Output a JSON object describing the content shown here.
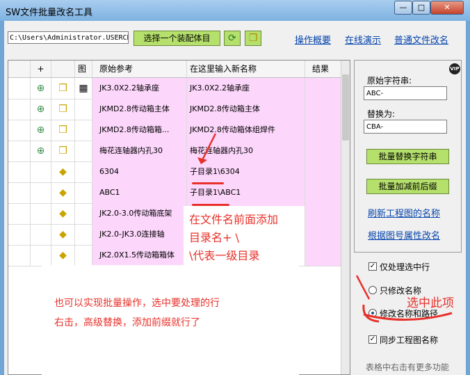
{
  "window": {
    "title": "SW文件批量改名工具",
    "minimize": "—",
    "maximize": "□",
    "close": "✕"
  },
  "toolbar": {
    "path_value": "C:\\Users\\Administrator.USERCH",
    "select_assembly_label": "选择一个装配体目",
    "refresh_icon": "refresh-icon",
    "assembly_icon": "assembly-icon"
  },
  "links": {
    "overview": "操作概要",
    "demo": "在线演示",
    "normal_rename": "普通文件改名"
  },
  "table": {
    "headers": {
      "plus": "+",
      "drawing": "图",
      "original": "原始参考",
      "new_name": "在这里输入新名称",
      "result": "结果"
    },
    "rows": [
      {
        "expand": "⊕",
        "icon": "assembly",
        "has_drawing": true,
        "original": "JK3.0X2.2轴承座",
        "new_name": "JK3.0X2.2轴承座"
      },
      {
        "expand": "⊕",
        "icon": "assembly",
        "has_drawing": false,
        "original": "JKMD2.8传动箱主体",
        "new_name": "JKMD2.8传动箱主体"
      },
      {
        "expand": "⊕",
        "icon": "assembly",
        "has_drawing": false,
        "original": "JKMD2.8传动箱箱...",
        "new_name": "JKMD2.8传动箱体组焊件"
      },
      {
        "expand": "⊕",
        "icon": "assembly",
        "has_drawing": false,
        "original": "梅花连轴器内孔30",
        "new_name": "梅花连轴器内孔30"
      },
      {
        "expand": "",
        "icon": "part",
        "has_drawing": false,
        "original": "6304",
        "new_name": "子目录1\\6304"
      },
      {
        "expand": "",
        "icon": "part",
        "has_drawing": false,
        "original": "ABC1",
        "new_name": "子目录1\\ABC1"
      },
      {
        "expand": "",
        "icon": "part",
        "has_drawing": false,
        "original": "JK2.0-3.0传动箱底架",
        "new_name": ""
      },
      {
        "expand": "",
        "icon": "part",
        "has_drawing": false,
        "original": "JK2.0-JK3.0连接轴",
        "new_name": ""
      },
      {
        "expand": "",
        "icon": "part",
        "has_drawing": false,
        "original": "JK2.0X1.5传动箱箱体",
        "new_name": ""
      }
    ]
  },
  "side": {
    "vip": "VIP",
    "find_label": "原始字符串:",
    "find_value": "ABC-",
    "replace_label": "替换为:",
    "replace_value": "CBA-",
    "batch_replace_btn": "批量替换字符串",
    "batch_prefix_btn": "批量加减前后缀",
    "refresh_drawing_link": "刷新工程图的名称",
    "rename_by_drawing_link": "根据图号属性改名",
    "only_selected": "仅处理选中行",
    "only_name": "只修改名称",
    "name_and_path": "修改名称和路径",
    "sync_drawing": "同步工程图名称",
    "more_hint": "表格中右击有更多功能"
  },
  "annotations": {
    "prefix_note": [
      "在文件名前面添加",
      "目录名+ \\",
      "\\代表一级目录"
    ],
    "select_this": "选中此项",
    "batch_note": [
      "也可以实现批量操作，选中要处理的行",
      "右击，高级替换，添加前缀就行了"
    ]
  },
  "colors": {
    "row_pink": "#fcd6fb",
    "button_green": "#b6e06c",
    "annotation_red": "#e8302a",
    "title_blue": "#7eb2e2"
  }
}
